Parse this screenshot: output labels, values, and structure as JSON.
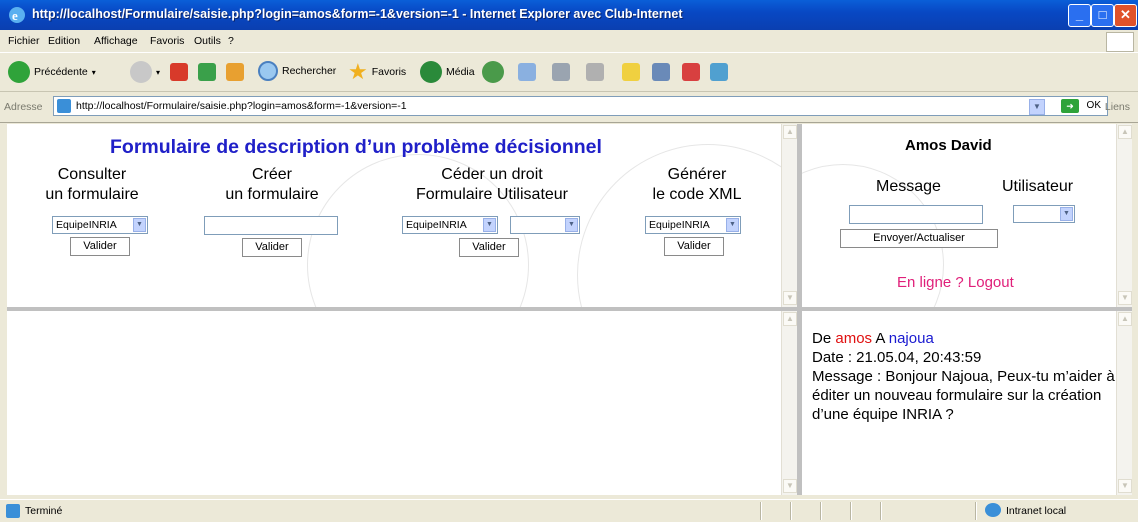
{
  "window": {
    "title": "http://localhost/Formulaire/saisie.php?login=amos&form=-1&version=-1 - Internet Explorer avec Club-Internet"
  },
  "menu": [
    "Fichier",
    "Edition",
    "Affichage",
    "Favoris",
    "Outils",
    "?"
  ],
  "toolbar": {
    "back": "Précédente",
    "search": "Rechercher",
    "favorites": "Favoris",
    "media": "Média"
  },
  "address": {
    "label": "Adresse",
    "url": "http://localhost/Formulaire/saisie.php?login=amos&form=-1&version=-1",
    "go": "OK",
    "links": "Liens"
  },
  "form": {
    "heading": "Formulaire de description d’un problème décisionnel",
    "consult": {
      "line1": "Consulter",
      "line2": "un formulaire",
      "select": "EquipeINRIA",
      "button": "Valider"
    },
    "create": {
      "line1": "Créer",
      "line2": "un formulaire",
      "input": "",
      "button": "Valider"
    },
    "cede": {
      "line1": "Céder un droit",
      "line2": "Formulaire Utilisateur",
      "select1": "EquipeINRIA",
      "select2": "",
      "button": "Valider"
    },
    "generate": {
      "line1": "Générer",
      "line2": "le code XML",
      "select": "EquipeINRIA",
      "button": "Valider"
    }
  },
  "user_panel": {
    "name": "Amos David",
    "message_label": "Message",
    "user_label": "Utilisateur",
    "message_input": "",
    "user_select": "",
    "send_button": "Envoyer/Actualiser",
    "online_link": "En ligne ?",
    "logout_link": "Logout"
  },
  "chat": {
    "from_prefix": "De",
    "from_user": "amos",
    "to_prefix": "A",
    "to_user": "najoua",
    "date_line": "Date : 21.05.04, 20:43:59",
    "message_line": "Message : Bonjour Najoua, Peux-tu m’aider à éditer un nouveau formulaire sur la création d’une équipe INRIA ?"
  },
  "status": {
    "text": "Terminé",
    "zone": "Intranet local"
  },
  "colors": {
    "heading": "#2020c8",
    "link_pink": "#e0207a",
    "from_red": "#e01010",
    "to_blue": "#1a1ad0"
  }
}
